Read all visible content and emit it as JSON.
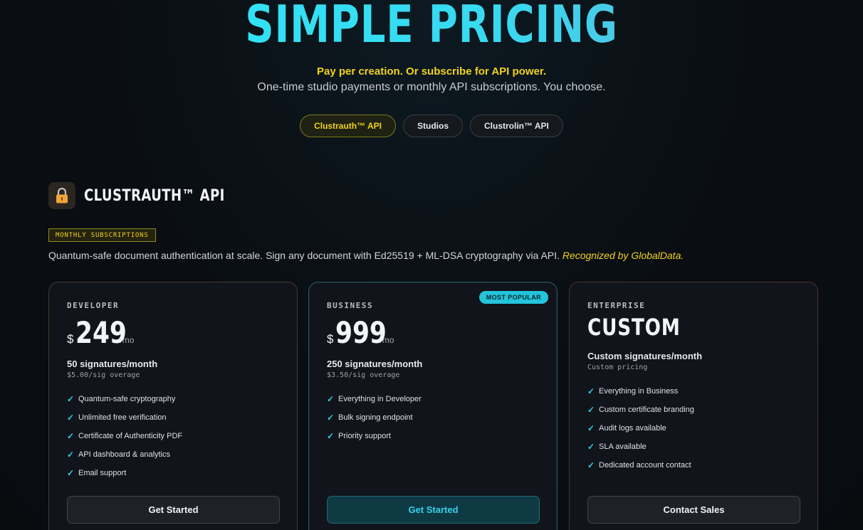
{
  "hero": {
    "title": "SIMPLE PRICING",
    "tagline": "Pay per creation. Or subscribe for API power.",
    "subtitle": "One-time studio payments or monthly API subscriptions. You choose."
  },
  "tabs": [
    {
      "label": "Clustrauth™ API",
      "active": true
    },
    {
      "label": "Studios",
      "active": false
    },
    {
      "label": "Clustrolin™ API",
      "active": false
    }
  ],
  "section": {
    "icon": "lock-icon",
    "title": "CLUSTRAUTH™ API",
    "pill": "MONTHLY SUBSCRIPTIONS",
    "description": "Quantum-safe document authentication at scale. Sign any document with Ed25519 + ML-DSA cryptography via API.",
    "recognition": "Recognized by GlobalData."
  },
  "plans": [
    {
      "tier": "DEVELOPER",
      "currency": "$",
      "price": "249",
      "period": "/mo",
      "signatures": "50 signatures/month",
      "overage": "$5.00/sig overage",
      "features": [
        "Quantum-safe cryptography",
        "Unlimited free verification",
        "Certificate of Authenticity PDF",
        "API dashboard & analytics",
        "Email support"
      ],
      "cta": "Get Started"
    },
    {
      "tier": "BUSINESS",
      "badge": "MOST POPULAR",
      "currency": "$",
      "price": "999",
      "period": "/mo",
      "signatures": "250 signatures/month",
      "overage": "$3.50/sig overage",
      "features": [
        "Everything in Developer",
        "Bulk signing endpoint",
        "Priority support"
      ],
      "cta": "Get Started"
    },
    {
      "tier": "ENTERPRISE",
      "price_label": "CUSTOM",
      "signatures": "Custom signatures/month",
      "overage": "Custom pricing",
      "features": [
        "Everything in Business",
        "Custom certificate branding",
        "Audit logs available",
        "SLA available",
        "Dedicated account contact"
      ],
      "cta": "Contact Sales"
    }
  ],
  "colors": {
    "accent_yellow": "#f2d21b",
    "accent_cyan": "#2ed3ea",
    "background": "#0a0f14"
  },
  "check_glyph": "✓"
}
